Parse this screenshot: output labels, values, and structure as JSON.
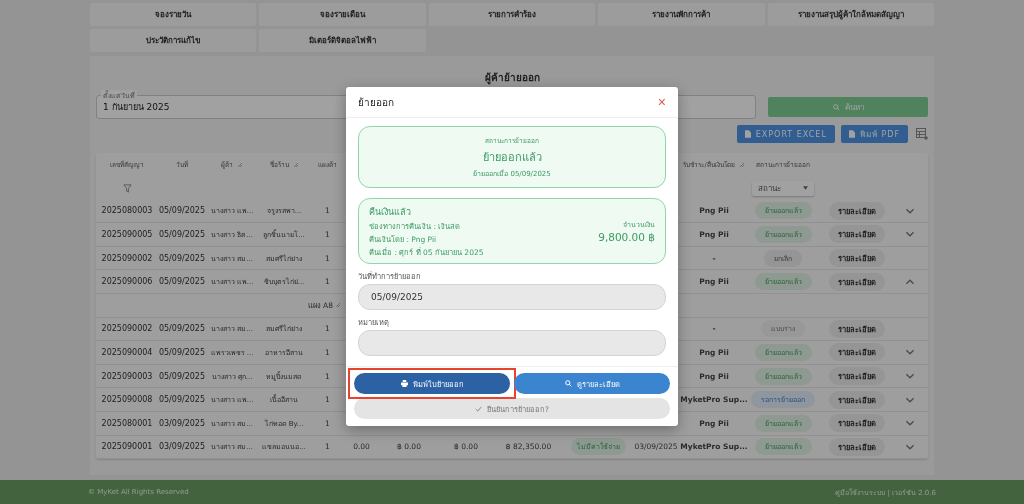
{
  "nav_tabs": [
    {
      "label": "จองรายวัน"
    },
    {
      "label": "จองรายเดือน"
    },
    {
      "label": "รายการคำร้อง"
    },
    {
      "label": "รายงานพักการค้า"
    },
    {
      "label": "รายงานสรุปผู้ค้าใกล้หมดสัญญา"
    },
    {
      "label": "ประวัติการแก้ไข"
    },
    {
      "label": "มิเตอร์ดิจิตอลไฟฟ้า"
    }
  ],
  "page_title": "ผู้ค้าย้ายออก",
  "date_filter": {
    "label": "ตั้งแต่วันที่",
    "value": "1 กันยายน 2025"
  },
  "search_button": "ค้นหา",
  "export_buttons": [
    {
      "label": "EXPORT EXCEL"
    },
    {
      "label": "พิมพ์ PDF"
    }
  ],
  "table": {
    "columns_left": [
      {
        "label": "เลขที่สัญญา",
        "resizable": false
      },
      {
        "label": "วันที่",
        "resizable": false
      },
      {
        "label": "ผู้ค้า",
        "resizable": true
      },
      {
        "label": "ชื่อร้าน",
        "resizable": true
      },
      {
        "label": "แผงค้า",
        "resizable": false
      }
    ],
    "columns_right": [
      {
        "label": "รับชำระ/คืนเงินโดย",
        "resizable": true
      },
      {
        "label": "สถานะการย้ายออก",
        "resizable": false
      }
    ],
    "status_filter": {
      "placeholder": "สถานะ"
    },
    "rows": [
      {
        "kind": "contract",
        "cells": [
          "2025080003",
          "05/09/2025",
          "นางสาว แพ...",
          "จรูงรสพา...",
          "1"
        ],
        "payer": "Png Pii",
        "status": {
          "label": "ย้ายออกแล้ว",
          "kind": "moved"
        },
        "details": "รายละเอียด",
        "expanded": false
      },
      {
        "kind": "contract",
        "cells": [
          "2025090005",
          "05/09/2025",
          "นางสาว ธิต...",
          "ลูกชิ้นนายโ...",
          "1"
        ],
        "payer": "Png Pii",
        "status": {
          "label": "ย้ายออกแล้ว",
          "kind": "moved"
        },
        "details": "รายละเอียด",
        "expanded": false
      },
      {
        "kind": "contract",
        "cells": [
          "2025090002",
          "05/09/2025",
          "นางสาว สม...",
          "สมศรีไก่ย่าง",
          "1"
        ],
        "payer": "-",
        "status": {
          "label": "ยกเลิก",
          "kind": "cancelled"
        },
        "details": "รายละเอียด"
      },
      {
        "kind": "contract",
        "cells": [
          "2025090006",
          "05/09/2025",
          "นางสาว แพ...",
          "ชิบบุตรไก่ย่...",
          "1"
        ],
        "payer": "Png Pii",
        "status": {
          "label": "ย้ายออกแล้ว",
          "kind": "moved"
        },
        "details": "รายละเอียด",
        "expanded": true
      },
      {
        "kind": "group",
        "label": "แผง A8"
      },
      {
        "kind": "contract",
        "cells": [
          "2025090002",
          "05/09/2025",
          "นางสาว สม...",
          "สมศรีไก่ย่าง",
          "1"
        ],
        "payer": "-",
        "status": {
          "label": "แบบร่าง",
          "kind": "draft"
        },
        "details": "รายละเอียด"
      },
      {
        "kind": "contract",
        "cells": [
          "2025090004",
          "05/09/2025",
          "แพรวเพชร ...",
          "อาหารอีสาน",
          "1"
        ],
        "payer": "Png Pii",
        "status": {
          "label": "ย้ายออกแล้ว",
          "kind": "moved"
        },
        "details": "รายละเอียด",
        "expanded": false
      },
      {
        "kind": "contract",
        "cells": [
          "2025090003",
          "05/09/2025",
          "นางสาว ศุก...",
          "หมูปิ้งนมสด",
          "1"
        ],
        "payer": "Png Pii",
        "status": {
          "label": "ย้ายออกแล้ว",
          "kind": "moved"
        },
        "details": "รายละเอียด",
        "expanded": false
      },
      {
        "kind": "contract",
        "cells": [
          "2025090008",
          "05/09/2025",
          "นางสาว แพ...",
          "เนื้ออีสาน",
          "1"
        ],
        "payer": "MyketPro Sup...",
        "status": {
          "label": "รอการย้ายออก",
          "kind": "pending"
        },
        "details": "รายละเอียด",
        "expanded": false
      },
      {
        "kind": "contract",
        "cells": [
          "2025080001",
          "03/09/2025",
          "นางสาว สม...",
          "ไก่ทอด By...",
          "1"
        ],
        "payer": "Png Pii",
        "status": {
          "label": "ย้ายออกแล้ว",
          "kind": "moved"
        },
        "details": "รายละเอียด",
        "expanded": false
      },
      {
        "kind": "contract",
        "cells": [
          "2025090001",
          "03/09/2025",
          "นางสาว สม...",
          "แซลมอนนอ...",
          "1"
        ],
        "middle": [
          "0.00",
          "฿ 0.00",
          "฿ 0.00",
          "฿ 82,350.00"
        ],
        "fee_badge": "ไม่มีค่าใช้จ่าย",
        "date": "03/09/2025",
        "payer": "MyketPro Sup...",
        "status": {
          "label": "ย้ายออกแล้ว",
          "kind": "moved"
        },
        "details": "รายละเอียด",
        "expanded": false
      }
    ]
  },
  "modal": {
    "title": "ย้ายออก",
    "close": "×",
    "status_card": {
      "caption": "สถานะการย้ายออก",
      "status": "ย้ายออกแล้ว",
      "date_text": "ย้ายออกเมื่อ 05/09/2025"
    },
    "refund_card": {
      "title": "คืนเงินแล้ว",
      "lines": [
        "ช่องทางการคืนเงิน : เงินสด",
        "คืนเงินโดย : Png Pii",
        "คืนเมื่อ : ศุกร์ ที่ 05 กันยายน 2025"
      ],
      "amount_label": "จำนวนเงิน",
      "amount": "9,800.00 ฿"
    },
    "fields": [
      {
        "label": "วันที่ทำการย้ายออก",
        "value": "05/09/2025"
      },
      {
        "label": "หมายเหตุ"
      }
    ],
    "actions": [
      {
        "label": "พิมพ์ใบย้ายออก",
        "kind": "print",
        "highlighted": true
      },
      {
        "label": "ดูรายละเอียด",
        "kind": "view",
        "highlighted": false
      }
    ],
    "confirm": {
      "label": "ยืนยันการย้ายออก?",
      "disabled": true
    }
  },
  "footer": {
    "copyright": "© MyKet All Rights Reserved",
    "links": "คู่มือใช้งานระบบ | เวอร์ชัน 2.0.6"
  }
}
